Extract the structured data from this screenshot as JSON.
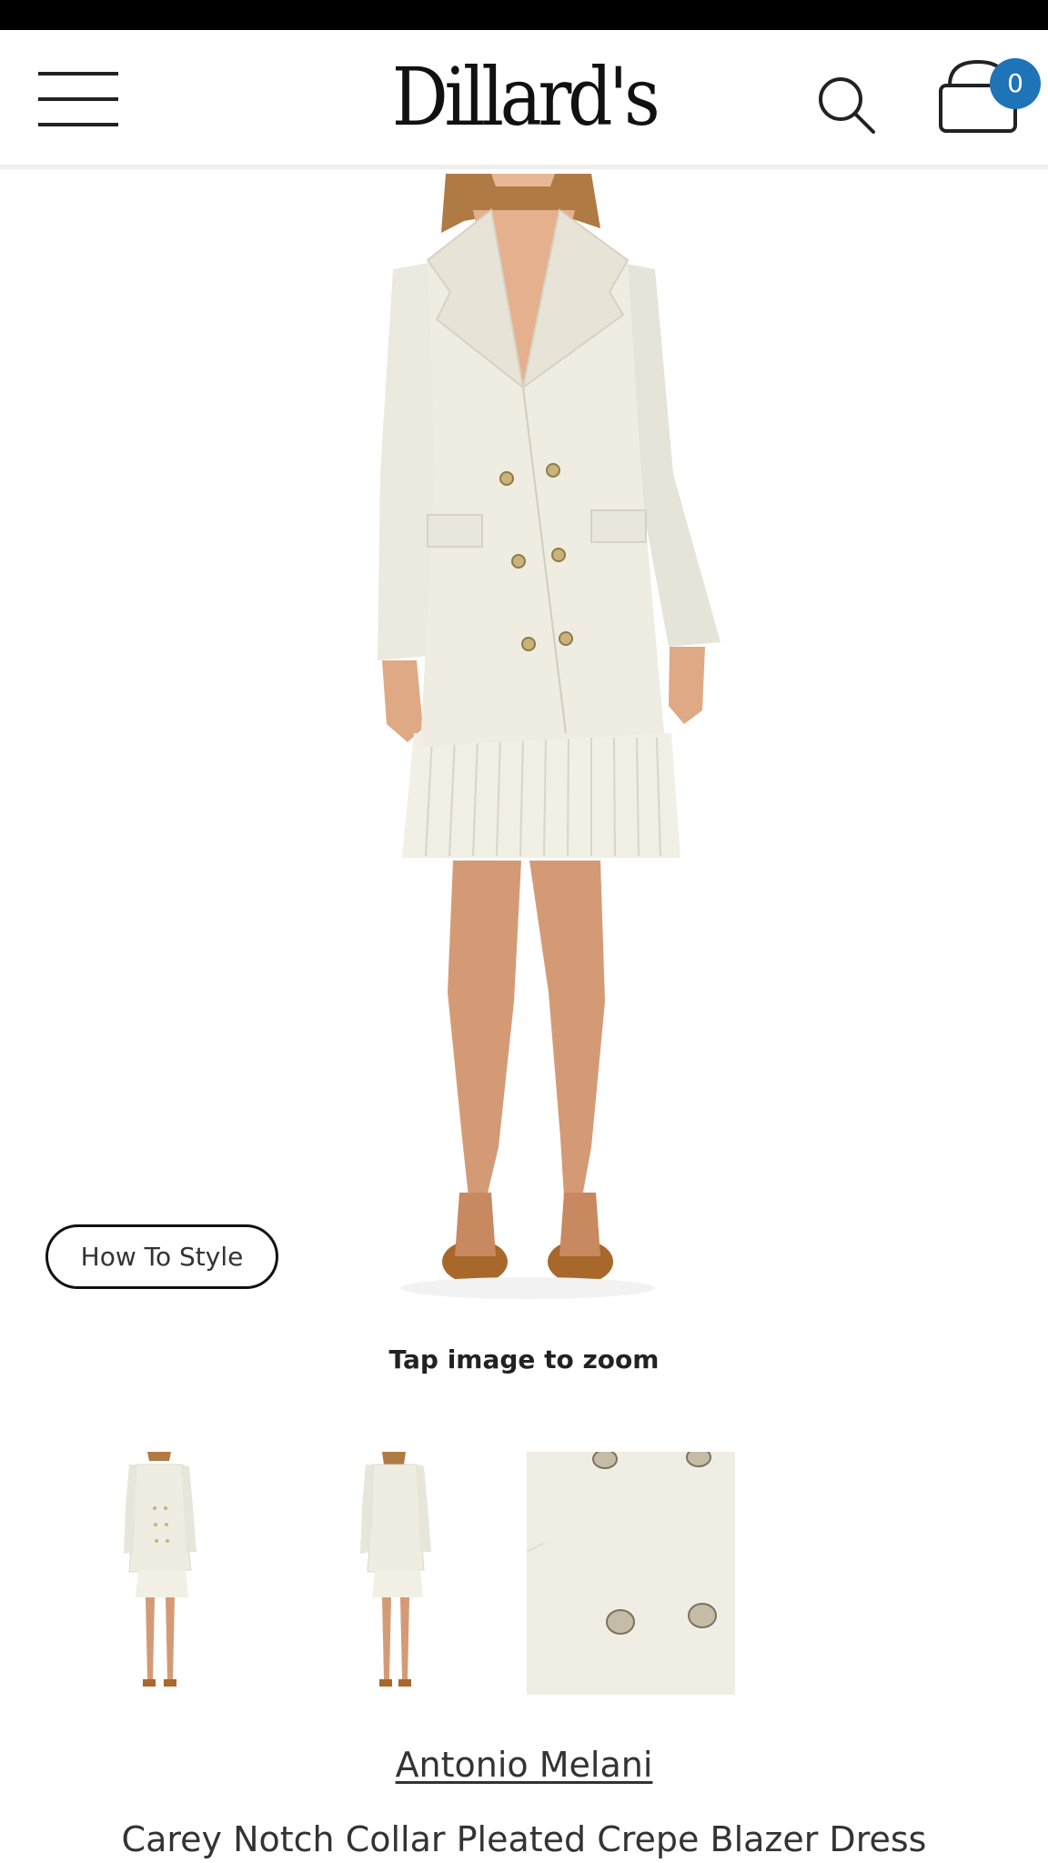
{
  "header": {
    "logo_text": "Dillard's",
    "cart_count": "0"
  },
  "product": {
    "how_to_style_label": "How To Style",
    "zoom_hint": "Tap image to zoom",
    "brand": "Antonio Melani",
    "name": "Carey Notch Collar Pleated Crepe Blazer Dress",
    "thumbnails": [
      "front view",
      "back view",
      "button detail"
    ]
  },
  "colors": {
    "badge": "#1f73b7",
    "garment": "#efece2",
    "skin": "#d9a07e",
    "shoes": "#a8682c"
  },
  "icons": [
    "menu-icon",
    "search-icon",
    "shopping-bag-icon"
  ]
}
